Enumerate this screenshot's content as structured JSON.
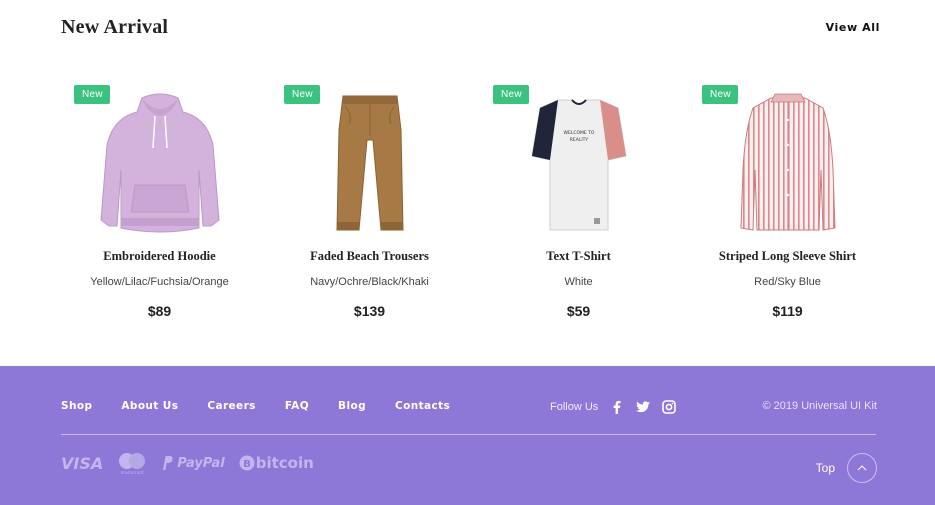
{
  "section": {
    "title": "New Arrival",
    "view_all": "View All"
  },
  "products": [
    {
      "badge": "New",
      "name": "Embroidered Hoodie",
      "colors": "Yellow/Lilac/Fuchsia/Orange",
      "price": "$89",
      "icon": "hoodie-image"
    },
    {
      "badge": "New",
      "name": "Faded Beach Trousers",
      "colors": "Navy/Ochre/Black/Khaki",
      "price": "$139",
      "icon": "trousers-image"
    },
    {
      "badge": "New",
      "name": "Text T-Shirt",
      "colors": "White",
      "price": "$59",
      "icon": "tshirt-image"
    },
    {
      "badge": "New",
      "name": "Striped Long Sleeve Shirt",
      "colors": "Red/Sky Blue",
      "price": "$119",
      "icon": "shirt-image"
    }
  ],
  "footer": {
    "nav": [
      "Shop",
      "About Us",
      "Careers",
      "FAQ",
      "Blog",
      "Contacts"
    ],
    "follow_label": "Follow Us",
    "social": [
      "facebook-icon",
      "twitter-icon",
      "instagram-icon"
    ],
    "copyright": "© 2019 Universal UI Kit",
    "payments": {
      "visa": "VISA",
      "mastercard": "mastercard",
      "paypal": "PayPal",
      "bitcoin": "bitcoin"
    },
    "top_label": "Top"
  },
  "colors": {
    "badge": "#3cc27f",
    "footer_bg": "#8d77d7"
  }
}
